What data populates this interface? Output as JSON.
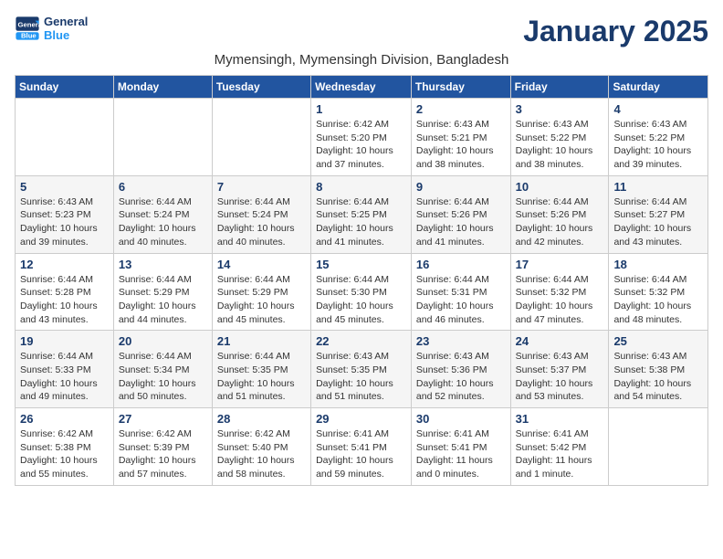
{
  "header": {
    "logo_general": "General",
    "logo_blue": "Blue",
    "month_title": "January 2025",
    "subtitle": "Mymensingh, Mymensingh Division, Bangladesh"
  },
  "weekdays": [
    "Sunday",
    "Monday",
    "Tuesday",
    "Wednesday",
    "Thursday",
    "Friday",
    "Saturday"
  ],
  "weeks": [
    [
      {
        "day": "",
        "info": ""
      },
      {
        "day": "",
        "info": ""
      },
      {
        "day": "",
        "info": ""
      },
      {
        "day": "1",
        "info": "Sunrise: 6:42 AM\nSunset: 5:20 PM\nDaylight: 10 hours and 37 minutes."
      },
      {
        "day": "2",
        "info": "Sunrise: 6:43 AM\nSunset: 5:21 PM\nDaylight: 10 hours and 38 minutes."
      },
      {
        "day": "3",
        "info": "Sunrise: 6:43 AM\nSunset: 5:22 PM\nDaylight: 10 hours and 38 minutes."
      },
      {
        "day": "4",
        "info": "Sunrise: 6:43 AM\nSunset: 5:22 PM\nDaylight: 10 hours and 39 minutes."
      }
    ],
    [
      {
        "day": "5",
        "info": "Sunrise: 6:43 AM\nSunset: 5:23 PM\nDaylight: 10 hours and 39 minutes."
      },
      {
        "day": "6",
        "info": "Sunrise: 6:44 AM\nSunset: 5:24 PM\nDaylight: 10 hours and 40 minutes."
      },
      {
        "day": "7",
        "info": "Sunrise: 6:44 AM\nSunset: 5:24 PM\nDaylight: 10 hours and 40 minutes."
      },
      {
        "day": "8",
        "info": "Sunrise: 6:44 AM\nSunset: 5:25 PM\nDaylight: 10 hours and 41 minutes."
      },
      {
        "day": "9",
        "info": "Sunrise: 6:44 AM\nSunset: 5:26 PM\nDaylight: 10 hours and 41 minutes."
      },
      {
        "day": "10",
        "info": "Sunrise: 6:44 AM\nSunset: 5:26 PM\nDaylight: 10 hours and 42 minutes."
      },
      {
        "day": "11",
        "info": "Sunrise: 6:44 AM\nSunset: 5:27 PM\nDaylight: 10 hours and 43 minutes."
      }
    ],
    [
      {
        "day": "12",
        "info": "Sunrise: 6:44 AM\nSunset: 5:28 PM\nDaylight: 10 hours and 43 minutes."
      },
      {
        "day": "13",
        "info": "Sunrise: 6:44 AM\nSunset: 5:29 PM\nDaylight: 10 hours and 44 minutes."
      },
      {
        "day": "14",
        "info": "Sunrise: 6:44 AM\nSunset: 5:29 PM\nDaylight: 10 hours and 45 minutes."
      },
      {
        "day": "15",
        "info": "Sunrise: 6:44 AM\nSunset: 5:30 PM\nDaylight: 10 hours and 45 minutes."
      },
      {
        "day": "16",
        "info": "Sunrise: 6:44 AM\nSunset: 5:31 PM\nDaylight: 10 hours and 46 minutes."
      },
      {
        "day": "17",
        "info": "Sunrise: 6:44 AM\nSunset: 5:32 PM\nDaylight: 10 hours and 47 minutes."
      },
      {
        "day": "18",
        "info": "Sunrise: 6:44 AM\nSunset: 5:32 PM\nDaylight: 10 hours and 48 minutes."
      }
    ],
    [
      {
        "day": "19",
        "info": "Sunrise: 6:44 AM\nSunset: 5:33 PM\nDaylight: 10 hours and 49 minutes."
      },
      {
        "day": "20",
        "info": "Sunrise: 6:44 AM\nSunset: 5:34 PM\nDaylight: 10 hours and 50 minutes."
      },
      {
        "day": "21",
        "info": "Sunrise: 6:44 AM\nSunset: 5:35 PM\nDaylight: 10 hours and 51 minutes."
      },
      {
        "day": "22",
        "info": "Sunrise: 6:43 AM\nSunset: 5:35 PM\nDaylight: 10 hours and 51 minutes."
      },
      {
        "day": "23",
        "info": "Sunrise: 6:43 AM\nSunset: 5:36 PM\nDaylight: 10 hours and 52 minutes."
      },
      {
        "day": "24",
        "info": "Sunrise: 6:43 AM\nSunset: 5:37 PM\nDaylight: 10 hours and 53 minutes."
      },
      {
        "day": "25",
        "info": "Sunrise: 6:43 AM\nSunset: 5:38 PM\nDaylight: 10 hours and 54 minutes."
      }
    ],
    [
      {
        "day": "26",
        "info": "Sunrise: 6:42 AM\nSunset: 5:38 PM\nDaylight: 10 hours and 55 minutes."
      },
      {
        "day": "27",
        "info": "Sunrise: 6:42 AM\nSunset: 5:39 PM\nDaylight: 10 hours and 57 minutes."
      },
      {
        "day": "28",
        "info": "Sunrise: 6:42 AM\nSunset: 5:40 PM\nDaylight: 10 hours and 58 minutes."
      },
      {
        "day": "29",
        "info": "Sunrise: 6:41 AM\nSunset: 5:41 PM\nDaylight: 10 hours and 59 minutes."
      },
      {
        "day": "30",
        "info": "Sunrise: 6:41 AM\nSunset: 5:41 PM\nDaylight: 11 hours and 0 minutes."
      },
      {
        "day": "31",
        "info": "Sunrise: 6:41 AM\nSunset: 5:42 PM\nDaylight: 11 hours and 1 minute."
      },
      {
        "day": "",
        "info": ""
      }
    ]
  ]
}
